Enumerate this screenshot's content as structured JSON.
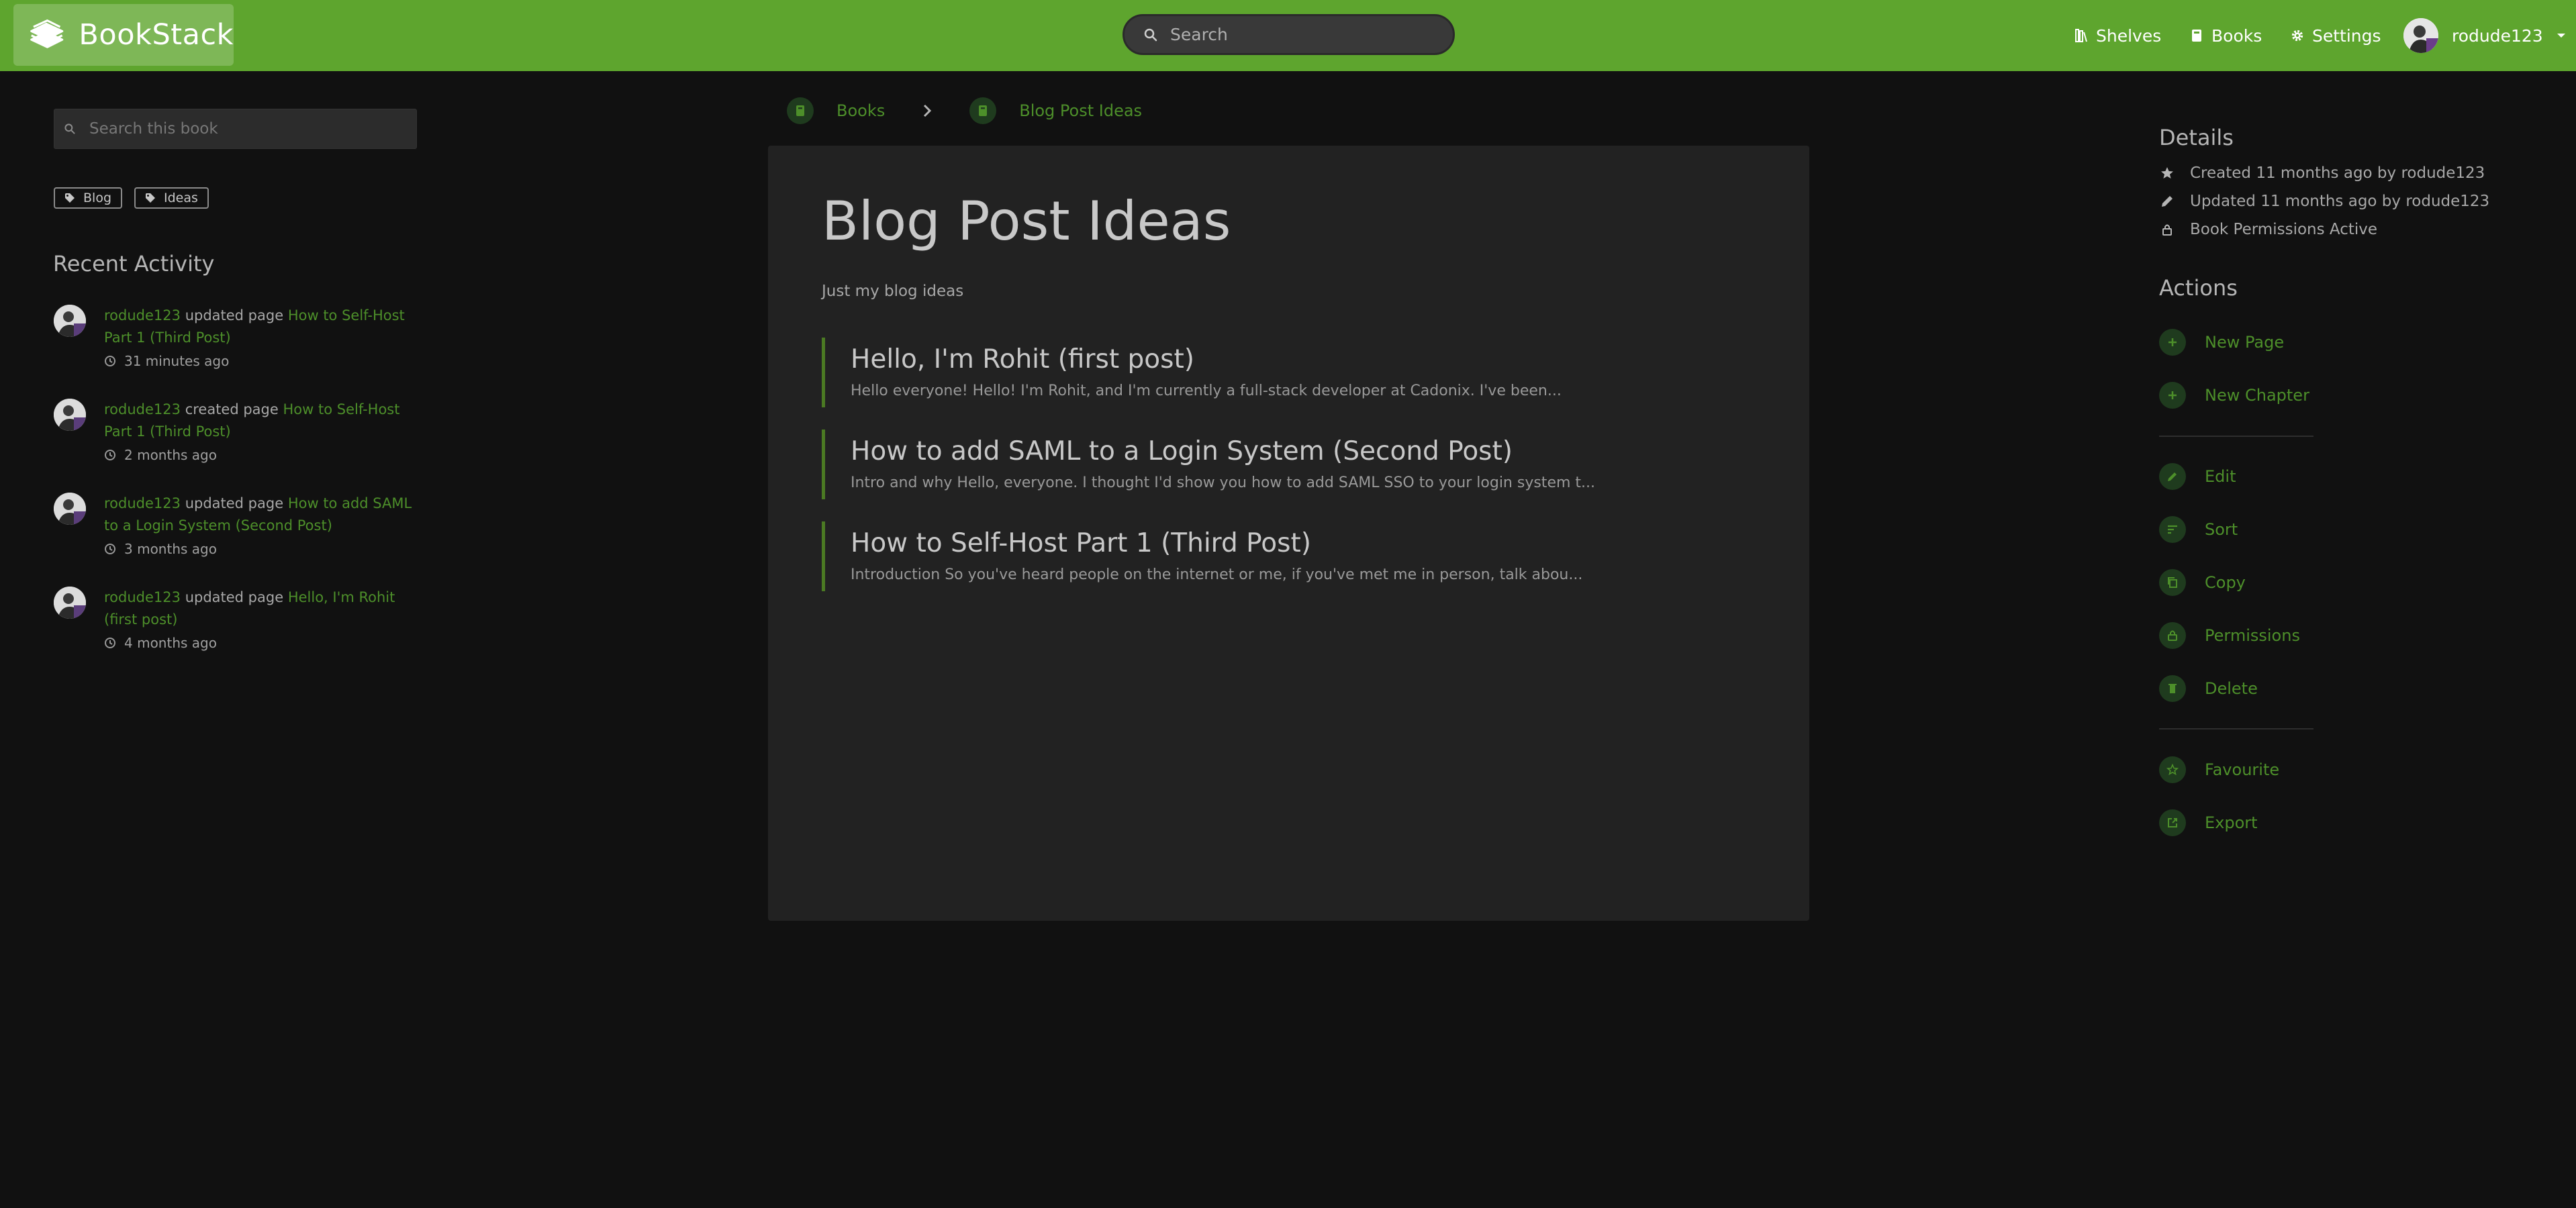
{
  "header": {
    "brand": "BookStack",
    "search_placeholder": "Search",
    "nav": {
      "shelves": "Shelves",
      "books": "Books",
      "settings": "Settings"
    },
    "user": "rodude123"
  },
  "sidebar_left": {
    "search_placeholder": "Search this book",
    "tags": [
      "Blog",
      "Ideas"
    ],
    "recent_heading": "Recent Activity",
    "activity": [
      {
        "user": "rodude123",
        "action": "updated page",
        "target": "How to Self-Host Part 1 (Third Post)",
        "time": "31 minutes ago"
      },
      {
        "user": "rodude123",
        "action": "created page",
        "target": "How to Self-Host Part 1 (Third Post)",
        "time": "2 months ago"
      },
      {
        "user": "rodude123",
        "action": "updated page",
        "target": "How to add SAML to a Login System (Second Post)",
        "time": "3 months ago"
      },
      {
        "user": "rodude123",
        "action": "updated page",
        "target": "Hello, I'm Rohit (first post)",
        "time": "4 months ago"
      }
    ]
  },
  "breadcrumb": {
    "books": "Books",
    "current": "Blog Post Ideas"
  },
  "book": {
    "title": "Blog Post Ideas",
    "description": "Just my blog ideas",
    "pages": [
      {
        "title": "Hello, I'm Rohit (first post)",
        "excerpt": "Hello everyone! Hello! I'm Rohit, and I'm currently a full-stack developer at Cadonix. I've been..."
      },
      {
        "title": "How to add SAML to a Login System (Second Post)",
        "excerpt": "Intro and why Hello, everyone. I thought I'd show you how to add SAML SSO to your login system t..."
      },
      {
        "title": "How to Self-Host Part 1 (Third Post)",
        "excerpt": "Introduction So you've heard people on the internet or me, if you've met me in person, talk abou..."
      }
    ]
  },
  "sidebar_right": {
    "details_heading": "Details",
    "details": {
      "created": "Created 11 months ago by rodude123",
      "updated": "Updated 11 months ago by rodude123",
      "permissions": "Book Permissions Active"
    },
    "actions_heading": "Actions",
    "actions": {
      "new_page": "New Page",
      "new_chapter": "New Chapter",
      "edit": "Edit",
      "sort": "Sort",
      "copy": "Copy",
      "permissions": "Permissions",
      "delete": "Delete",
      "favourite": "Favourite",
      "export": "Export"
    }
  },
  "colors": {
    "header": "#5ea52e",
    "link": "#4d8f2a",
    "background": "#111111",
    "card": "#222222"
  }
}
